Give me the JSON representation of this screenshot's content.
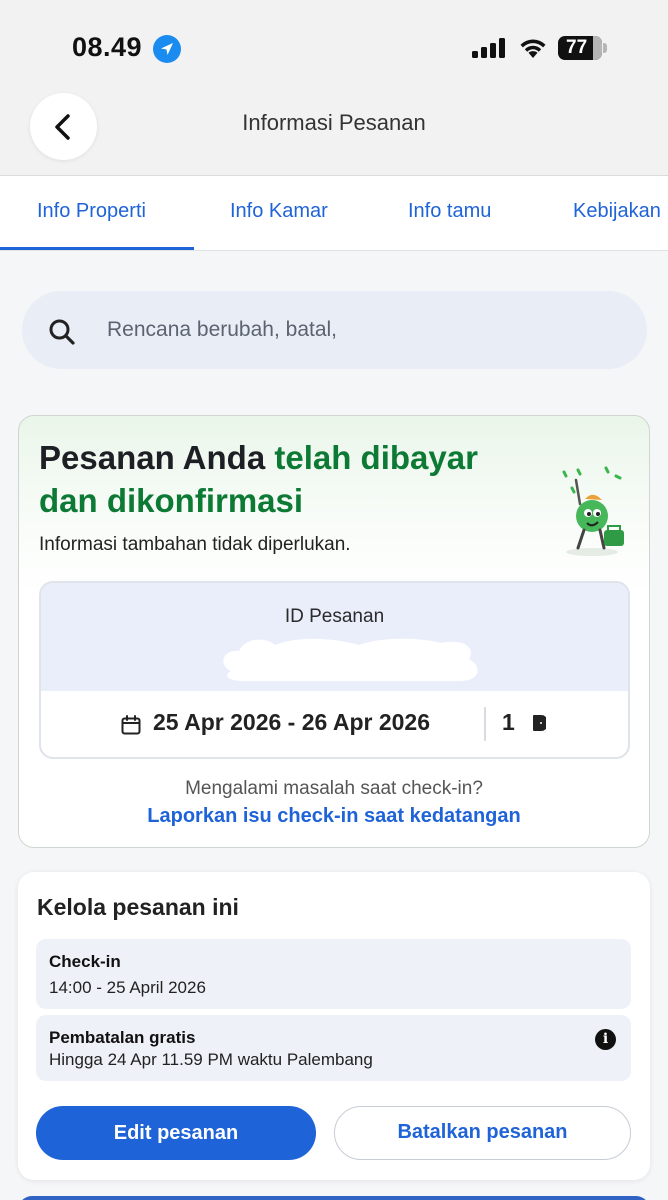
{
  "status_bar": {
    "time": "08.49",
    "battery": "77",
    "icons": [
      "location-arrow-icon",
      "cellular-signal-icon",
      "wifi-icon",
      "battery-icon"
    ]
  },
  "header": {
    "title": "Informasi Pesanan",
    "back_icon": "chevron-left-icon"
  },
  "tabs": [
    {
      "label": "Info Properti",
      "active": true
    },
    {
      "label": "Info Kamar",
      "active": false
    },
    {
      "label": "Info tamu",
      "active": false
    },
    {
      "label": "Kebijakan",
      "active": false
    }
  ],
  "search": {
    "placeholder": "Rencana berubah, batal,",
    "icon": "search-icon"
  },
  "status_card": {
    "title_prefix": "Pesanan Anda ",
    "title_highlight": "telah dibayar dan dikonfirmasi",
    "subtitle": "Informasi tambahan tidak diperlukan.",
    "id_label": "ID Pesanan",
    "dates": "25 Apr 2026 - 26 Apr 2026",
    "guests": "1",
    "checkin_issue_question": "Mengalami masalah saat check-in?",
    "checkin_issue_link": "Laporkan isu check-in saat kedatangan"
  },
  "manage_card": {
    "title": "Kelola pesanan ini",
    "checkin_label": "Check-in",
    "checkin_value": "14:00 - 25 April 2026",
    "cancellation_label": "Pembatalan gratis",
    "cancellation_value": "Hingga 24 Apr 11.59 PM waktu Palembang",
    "edit_button": "Edit pesanan",
    "cancel_button": "Batalkan pesanan"
  },
  "colors": {
    "accent": "#1f63d8",
    "success": "#0c7a34",
    "search_bg": "#e9edf6",
    "info_bg": "#eef1f8"
  }
}
